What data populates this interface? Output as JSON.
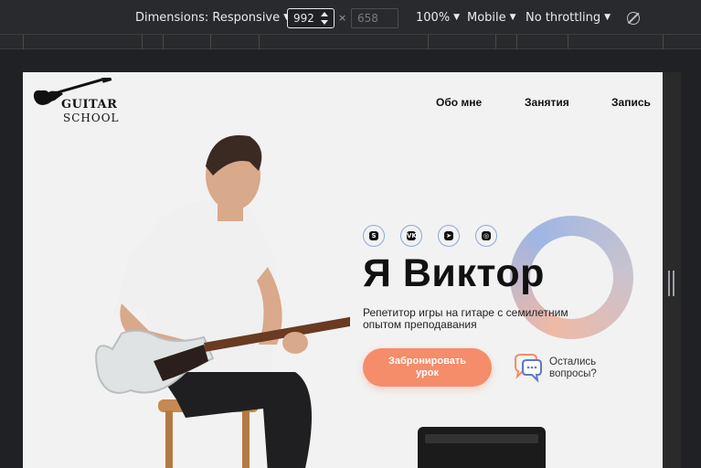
{
  "devtools": {
    "dimensions_label": "Dimensions: Responsive",
    "width_value": "992",
    "height_value": "658",
    "times_symbol": "×",
    "zoom": "100%",
    "device": "Mobile",
    "throttling": "No throttling",
    "icons": {
      "dropdown": "caret-down-icon",
      "rotate": "rotate-icon",
      "spinner": "spinner-icon"
    }
  },
  "site": {
    "logo": {
      "line1": "GUITAR",
      "line2": "SCHOOL",
      "icon": "guitar-icon"
    },
    "nav": [
      "Обо мне",
      "Занятия",
      "Запись"
    ],
    "socials": [
      {
        "name": "skype",
        "glyph": "S"
      },
      {
        "name": "vk",
        "glyph": "VK"
      },
      {
        "name": "telegram",
        "glyph": "➤"
      },
      {
        "name": "instagram",
        "glyph": "◎"
      }
    ],
    "hero": {
      "title": "Я Виктор",
      "subtitle": "Репетитор игры на гитаре с семилетним опытом преподавания",
      "cta": "Забронировать урок",
      "questions": "Остались вопросы?"
    },
    "colors": {
      "accent": "#f58c6a",
      "background": "#f2f2f2",
      "social_border": "#8fa7d8",
      "text": "#111111"
    }
  }
}
